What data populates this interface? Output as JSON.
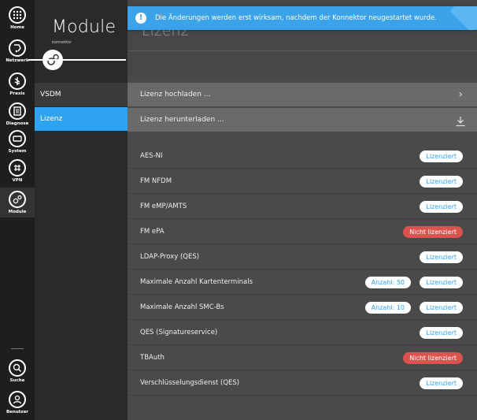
{
  "rail": {
    "items": [
      {
        "label": "Home",
        "icon": "home-grid-icon"
      },
      {
        "label": "Netzwerk",
        "icon": "network-icon"
      },
      {
        "label": "Praxis",
        "icon": "praxis-icon"
      },
      {
        "label": "Diagnose",
        "icon": "diagnose-icon"
      },
      {
        "label": "System",
        "icon": "system-icon"
      },
      {
        "label": "VPN",
        "icon": "vpn-icon"
      },
      {
        "label": "Module",
        "icon": "module-icon"
      }
    ],
    "bottom": [
      {
        "label": "Suche",
        "icon": "search-icon"
      },
      {
        "label": "Benutzer",
        "icon": "user-icon"
      }
    ]
  },
  "module_panel": {
    "title": "Module",
    "subtitle": "konnektor",
    "items": [
      "VSDM",
      "Lizenz"
    ]
  },
  "main": {
    "title": "Lizenz",
    "actions": [
      "Lizenz hochladen ...",
      "Lizenz herunterladen ..."
    ]
  },
  "notification": {
    "text": "Die Änderungen werden erst wirksam, nachdem der Konnektor neugestartet wurde."
  },
  "licenses": [
    {
      "name": "AES-NI",
      "status": "Lizenziert",
      "licensed": true,
      "count": ""
    },
    {
      "name": "FM NFDM",
      "status": "Lizenziert",
      "licensed": true,
      "count": ""
    },
    {
      "name": "FM eMP/AMTS",
      "status": "Lizenziert",
      "licensed": true,
      "count": ""
    },
    {
      "name": "FM ePA",
      "status": "Nicht lizenziert",
      "licensed": false,
      "count": ""
    },
    {
      "name": "LDAP-Proxy (QES)",
      "status": "Lizenziert",
      "licensed": true,
      "count": ""
    },
    {
      "name": "Maximale Anzahl Kartenterminals",
      "status": "Lizenziert",
      "licensed": true,
      "count": "Anzahl: 50"
    },
    {
      "name": "Maximale Anzahl SMC-Bs",
      "status": "Lizenziert",
      "licensed": true,
      "count": "Anzahl: 10"
    },
    {
      "name": "QES (Signatureservice)",
      "status": "Lizenziert",
      "licensed": true,
      "count": ""
    },
    {
      "name": "TBAuth",
      "status": "Nicht lizenziert",
      "licensed": false,
      "count": ""
    },
    {
      "name": "Verschlüsselungsdienst (QES)",
      "status": "Lizenziert",
      "licensed": true,
      "count": ""
    }
  ],
  "colors": {
    "accent": "#2ea3f2",
    "danger": "#d9534f",
    "rail_bg": "#1e1e1e",
    "panel_bg": "#2a2a2a",
    "main_bg": "#4a4a4a"
  }
}
